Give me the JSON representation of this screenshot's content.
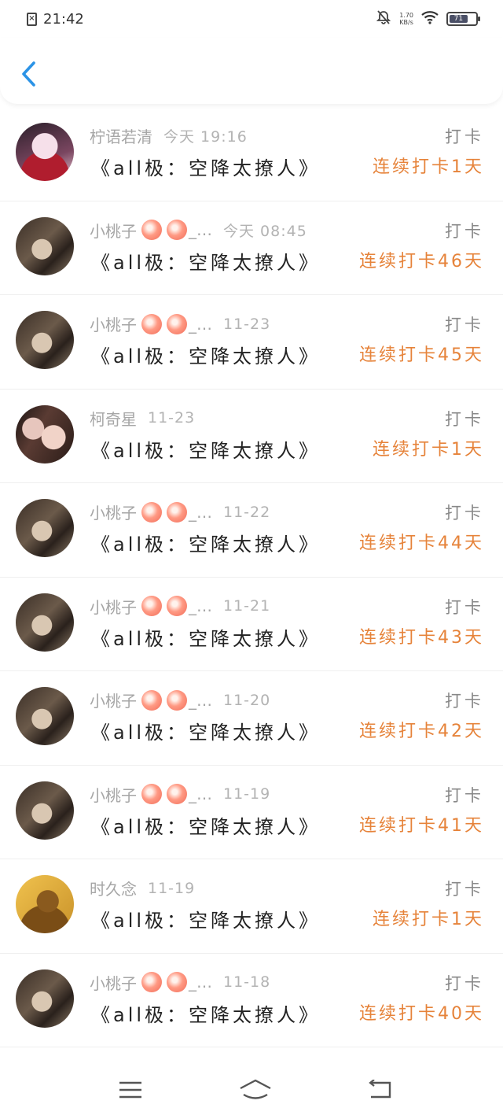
{
  "status_bar": {
    "time": "21:42",
    "net_speed_value": "1.70",
    "net_speed_unit": "KB/s",
    "battery_level": "71"
  },
  "colors": {
    "accent_blue": "#2b93e6",
    "streak_orange": "#e6833a",
    "muted_gray": "#a6a6a6"
  },
  "entries": [
    {
      "name": "柠语若清",
      "peaches": false,
      "time": "今天 19:16",
      "book": "《all极：空降太撩人》",
      "tag": "打卡",
      "streak": "连续打卡1天",
      "avatar": "a1"
    },
    {
      "name": "小桃子",
      "peaches": true,
      "time": "今天 08:45",
      "book": "《all极：空降太撩人》",
      "tag": "打卡",
      "streak": "连续打卡46天",
      "avatar": "a2"
    },
    {
      "name": "小桃子",
      "peaches": true,
      "time": "11-23",
      "book": "《all极：空降太撩人》",
      "tag": "打卡",
      "streak": "连续打卡45天",
      "avatar": "a2"
    },
    {
      "name": "柯奇星",
      "peaches": false,
      "time": "11-23",
      "book": "《all极：空降太撩人》",
      "tag": "打卡",
      "streak": "连续打卡1天",
      "avatar": "a3"
    },
    {
      "name": "小桃子",
      "peaches": true,
      "time": "11-22",
      "book": "《all极：空降太撩人》",
      "tag": "打卡",
      "streak": "连续打卡44天",
      "avatar": "a2"
    },
    {
      "name": "小桃子",
      "peaches": true,
      "time": "11-21",
      "book": "《all极：空降太撩人》",
      "tag": "打卡",
      "streak": "连续打卡43天",
      "avatar": "a2"
    },
    {
      "name": "小桃子",
      "peaches": true,
      "time": "11-20",
      "book": "《all极：空降太撩人》",
      "tag": "打卡",
      "streak": "连续打卡42天",
      "avatar": "a2"
    },
    {
      "name": "小桃子",
      "peaches": true,
      "time": "11-19",
      "book": "《all极：空降太撩人》",
      "tag": "打卡",
      "streak": "连续打卡41天",
      "avatar": "a2"
    },
    {
      "name": "时久念",
      "peaches": false,
      "time": "11-19",
      "book": "《all极：空降太撩人》",
      "tag": "打卡",
      "streak": "连续打卡1天",
      "avatar": "a4"
    },
    {
      "name": "小桃子",
      "peaches": true,
      "time": "11-18",
      "book": "《all极：空降太撩人》",
      "tag": "打卡",
      "streak": "连续打卡40天",
      "avatar": "a2"
    }
  ],
  "peach_suffix": "_…",
  "icons": {
    "back": "chevron-left-icon",
    "menu": "menu-icon",
    "home": "home-icon",
    "return": "return-icon",
    "peach": "peach-emoji-icon"
  }
}
